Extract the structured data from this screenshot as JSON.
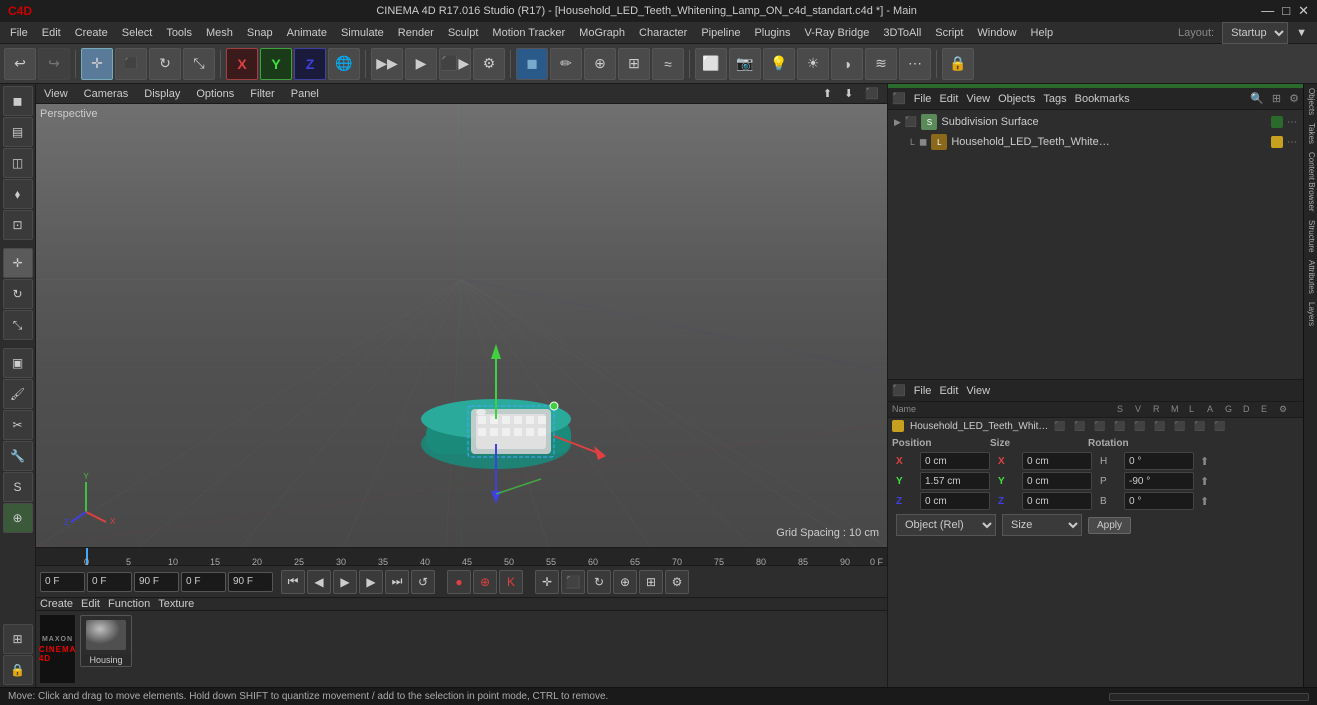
{
  "titlebar": {
    "title": "CINEMA 4D R17.016 Studio (R17) - [Household_LED_Teeth_Whitening_Lamp_ON_c4d_standart.c4d *] - Main",
    "close": "✕",
    "maximize": "□",
    "minimize": "—"
  },
  "menubar": {
    "items": [
      "File",
      "Edit",
      "Create",
      "Select",
      "Tools",
      "Mesh",
      "Snap",
      "Animate",
      "Simulate",
      "Render",
      "Sculpt",
      "Motion Tracker",
      "MoGraph",
      "Character",
      "Pipeline",
      "Plugins",
      "V-Ray Bridge",
      "3DToAll",
      "Script",
      "Window",
      "Help"
    ]
  },
  "right_menus": {
    "layout_label": "Layout:",
    "layout_value": "Startup"
  },
  "top_panel_tabs": {
    "items": [
      "File",
      "Edit",
      "View",
      "Objects",
      "Tags",
      "Bookmarks"
    ]
  },
  "obj_manager": {
    "subdivision_surface": "Subdivision Surface",
    "object_name": "Household_LED_Teeth_Whitening_Lamp_ON"
  },
  "viewport": {
    "label": "Perspective",
    "grid_spacing": "Grid Spacing : 10 cm",
    "header_items": [
      "View",
      "Cameras",
      "Display",
      "Options",
      "Filter",
      "Panel"
    ]
  },
  "bottom_panel": {
    "tabs": {
      "file": "File",
      "edit": "Edit",
      "view": "View",
      "objects": "Objects",
      "tags": "Tags",
      "bookmarks": "Bookmarks"
    },
    "toolbar_items": [
      "Create",
      "Edit",
      "Function",
      "Texture"
    ]
  },
  "attributes": {
    "position": {
      "label": "Position",
      "x_label": "X",
      "x_value": "0 cm",
      "y_label": "Y",
      "y_value": "1.57 cm",
      "z_label": "Z",
      "z_value": "0 cm"
    },
    "size": {
      "label": "Size",
      "x_label": "X",
      "x_value": "0 cm",
      "y_label": "Y",
      "y_value": "0 cm",
      "z_label": "Z",
      "z_value": "0 cm"
    },
    "rotation": {
      "label": "Rotation",
      "h_label": "H",
      "h_value": "0 °",
      "p_label": "P",
      "p_value": "-90 °",
      "b_label": "B",
      "b_value": "0 °"
    },
    "coord_system": "Object (Rel)",
    "size_system": "Size",
    "apply_btn": "Apply"
  },
  "timeline": {
    "frame_start": "0 F",
    "frame_current": "0 F",
    "frame_end": "90 F",
    "preview_start": "0 F",
    "preview_end": "90 F",
    "ticks": [
      "0",
      "5",
      "10",
      "15",
      "20",
      "25",
      "30",
      "35",
      "40",
      "45",
      "50",
      "55",
      "60",
      "65",
      "70",
      "75",
      "80",
      "85",
      "90"
    ],
    "frame_indicator": "0 F"
  },
  "material": {
    "name": "Housing"
  },
  "statusbar": {
    "text": "Move: Click and drag to move elements. Hold down SHIFT to quantize movement / add to the selection in point mode, CTRL to remove."
  },
  "bottom_obj_manager": {
    "file": "File",
    "edit": "Edit",
    "view": "View",
    "name_col": "Name",
    "object_name": "Household_LED_Teeth_Whitening_Lamp_ON",
    "col_headers": [
      "S",
      "V",
      "R",
      "M",
      "L",
      "A",
      "G",
      "D",
      "E"
    ]
  },
  "right_side_tabs": [
    "Objects",
    "Takes",
    "Content Browser",
    "Structure",
    "Attributes",
    "Layers"
  ],
  "icons": {
    "undo": "↩",
    "move": "✛",
    "rotate": "↻",
    "scale": "⤡",
    "x_axis": "X",
    "y_axis": "Y",
    "z_axis": "Z",
    "play": "▶",
    "pause": "⏸",
    "stop": "■",
    "rewind": "⏮",
    "forward": "⏭",
    "record": "●"
  }
}
